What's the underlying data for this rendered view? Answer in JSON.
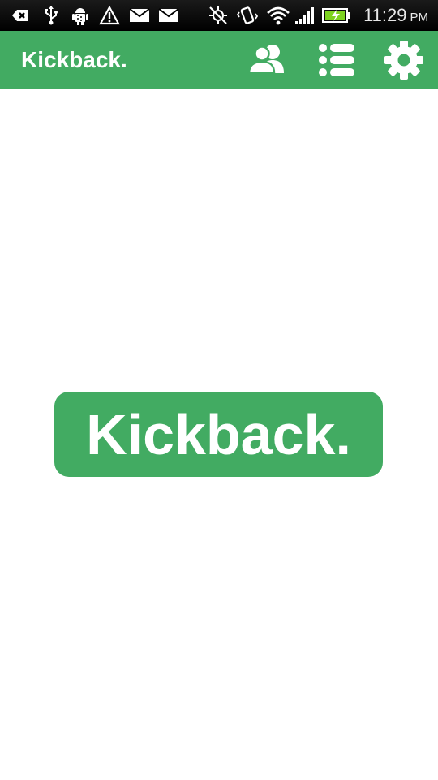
{
  "status_bar": {
    "time": "11:29",
    "ampm": "PM",
    "icons": [
      "back-notification-icon",
      "usb-icon",
      "android-debug-icon",
      "warning-icon",
      "mail-icon",
      "mail-icon",
      "gps-off-icon",
      "vibrate-icon",
      "wifi-icon",
      "signal-icon",
      "battery-charging-icon"
    ]
  },
  "app_bar": {
    "title": "Kickback.",
    "actions": [
      "people-icon",
      "list-icon",
      "settings-gear-icon"
    ]
  },
  "main": {
    "logo_text": "Kickback."
  },
  "colors": {
    "brand_green": "#42ab62",
    "status_bar": "#000000",
    "background": "#ffffff"
  }
}
